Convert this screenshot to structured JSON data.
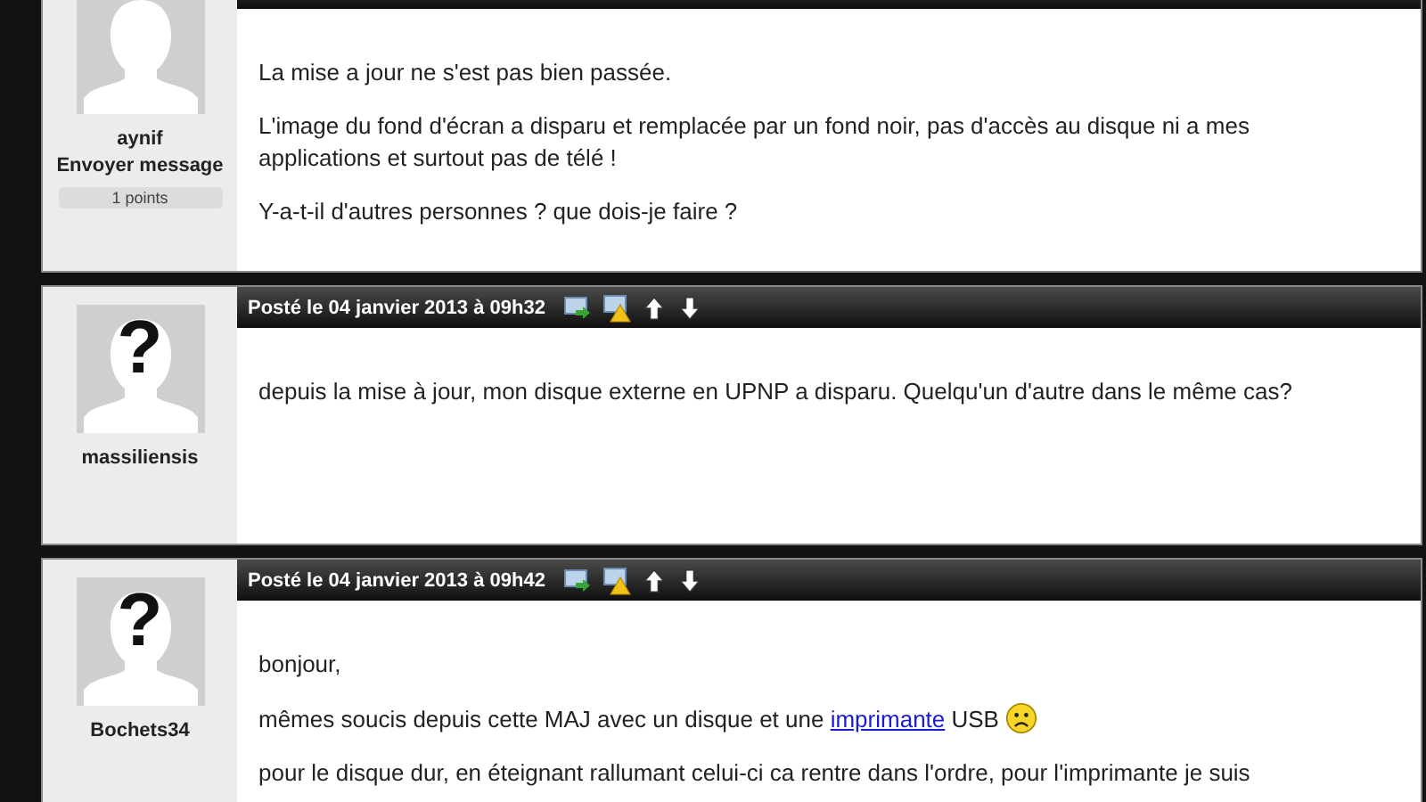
{
  "posts": [
    {
      "author": "aynif",
      "send_message": "Envoyer message",
      "points": "1 points",
      "paragraphs": [
        [
          {
            "kind": "text",
            "text": "La mise a jour ne s'est pas bien passée."
          }
        ],
        [
          {
            "kind": "text",
            "text": "L'image du fond d'écran a disparu et remplacée par un fond noir, pas d'accès au disque ni a mes applications et surtout pas de télé !"
          }
        ],
        [
          {
            "kind": "text",
            "text": "Y-a-t-il d'autres personnes ? que dois-je faire ?"
          }
        ]
      ]
    },
    {
      "posted": "Posté le 04 janvier 2013 à 09h32",
      "avatar_mark": "?",
      "author": "massiliensis",
      "paragraphs": [
        [
          {
            "kind": "text",
            "text": "depuis la mise à jour, mon disque externe en UPNP a disparu. Quelqu'un d'autre dans le même cas?"
          }
        ]
      ]
    },
    {
      "posted": "Posté le 04 janvier 2013 à 09h42",
      "avatar_mark": "?",
      "author": "Bochets34",
      "paragraphs": [
        [
          {
            "kind": "text",
            "text": "bonjour,"
          }
        ],
        [
          {
            "kind": "text",
            "text": "mêmes soucis depuis cette MAJ avec un disque et une "
          },
          {
            "kind": "link",
            "text": "imprimante"
          },
          {
            "kind": "text",
            "text": " USB "
          },
          {
            "kind": "emoticon"
          }
        ],
        [
          {
            "kind": "text",
            "text": "pour le disque dur, en éteignant rallumant celui-ci ca rentre dans l'ordre, pour l'imprimante je suis"
          }
        ]
      ]
    }
  ]
}
